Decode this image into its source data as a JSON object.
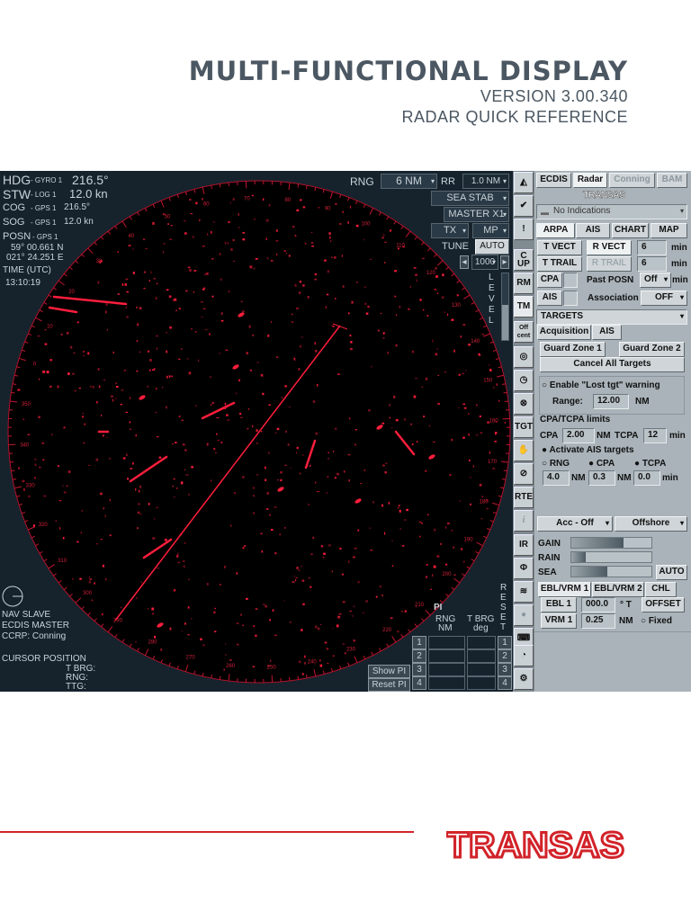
{
  "header": {
    "title": "MULTI-FUNCTIONAL DISPLAY",
    "version": "VERSION 3.00.340",
    "subtitle": "RADAR QUICK REFERENCE"
  },
  "nav": {
    "hdg_label": "HDG",
    "hdg_src": "- GYRO 1",
    "hdg_val": "216.5°",
    "stw_label": "STW",
    "stw_src": "- LOG 1",
    "stw_val": "12.0 kn",
    "cog_label": "COG",
    "cog_src": "- GPS 1",
    "cog_val": "216.5°",
    "sog_label": "SOG",
    "sog_src": "- GPS 1",
    "sog_val": "12.0 kn",
    "posn_label": "POSN",
    "posn_src": "- GPS 1",
    "lat": "59° 00.661 N",
    "lon": "021° 24.251 E",
    "time_label": "TIME (UTC)",
    "time": "13:10:19"
  },
  "status": {
    "nav_slave": "NAV SLAVE",
    "ecdis_master": "ECDIS MASTER",
    "ccrp": "CCRP:  Conning",
    "cursor": "CURSOR POSITION",
    "tbrg": "T BRG:",
    "rng": "RNG:",
    "ttg": "TTG:"
  },
  "radar_ctrl": {
    "rng_label": "RNG",
    "rng_value": "6 NM",
    "rr_label": "RR",
    "rr_value": "1.0 NM",
    "sea_stab": "SEA STAB",
    "master": "MASTER X1",
    "tx": "TX",
    "mp": "MP",
    "tune_label": "TUNE",
    "tune_mode": "AUTO",
    "tune_value": "1000",
    "level": "LEVEL"
  },
  "bearing_scale": [
    "0",
    "10",
    "20",
    "30",
    "40",
    "50",
    "60",
    "70",
    "80",
    "90",
    "100",
    "110",
    "120",
    "130",
    "140",
    "150",
    "160",
    "170",
    "180",
    "190",
    "200",
    "210",
    "220",
    "230",
    "240",
    "250",
    "260",
    "270",
    "280",
    "290",
    "300",
    "310",
    "320",
    "330",
    "340",
    "350"
  ],
  "pi": {
    "title": "PI",
    "rng": "RNG",
    "nm": "NM",
    "tbrg": "T BRG",
    "deg": "deg",
    "reset": "RESET",
    "rows": [
      "1",
      "2",
      "3",
      "4"
    ],
    "show": "Show PI",
    "reset_btn": "Reset PI"
  },
  "toolbar": {
    "cup": "C\nUP",
    "rm": "RM",
    "tm": "TM",
    "offcent": "Off cent",
    "tgt": "TGT",
    "rte": "RTE",
    "info": "i",
    "ir": "IR"
  },
  "panel": {
    "tabs": [
      "ECDIS",
      "Radar",
      "Conning",
      "BAM"
    ],
    "brand": "TRANSAS",
    "indications": "No Indications",
    "subtabs": [
      "ARPA",
      "AIS",
      "CHART",
      "MAP"
    ],
    "t_vect": "T VECT",
    "r_vect": "R VECT",
    "vect_val": "6",
    "min": "min",
    "t_trail": "T TRAIL",
    "r_trail": "R TRAIL",
    "trail_val": "6",
    "cpa": "CPA",
    "past_posn": "Past POSN",
    "past_val": "Off",
    "ais": "AIS",
    "association": "Association",
    "assoc_val": "OFF",
    "targets": "TARGETS",
    "acq_tabs": [
      "Acquisition",
      "AIS"
    ],
    "gz1": "Guard Zone 1",
    "gz2": "Guard Zone 2",
    "cancel": "Cancel All Targets",
    "lost": "Enable \"Lost tgt\" warning",
    "range_label": "Range:",
    "range_val": "12.00",
    "nm": "NM",
    "limits": "CPA/TCPA limits",
    "cpa_val": "2.00",
    "tcpa": "TCPA",
    "tcpa_val": "12",
    "activate": "Activate AIS targets",
    "rng": "RNG",
    "ais_rng": "4.0",
    "ais_cpa": "0.3",
    "ais_tcpa": "0.0",
    "acc": "Acc - Off",
    "offshore": "Offshore",
    "gain": "GAIN",
    "rain": "RAIN",
    "sea": "SEA",
    "auto": "AUTO",
    "gain_level": 0.65,
    "rain_level": 0.18,
    "sea_level": 0.45,
    "ebl_tabs": [
      "EBL/VRM 1",
      "EBL/VRM 2",
      "CHL"
    ],
    "ebl1": "EBL 1",
    "ebl_val": "000.0",
    "deg_t": "° T",
    "offset": "OFFSET",
    "vrm1": "VRM 1",
    "vrm_val": "0.25",
    "fixed": "Fixed"
  },
  "footer": {
    "logo": "TRANSAS"
  },
  "colors": {
    "echo": "#ff1e3c",
    "brand": "#d2232a"
  }
}
